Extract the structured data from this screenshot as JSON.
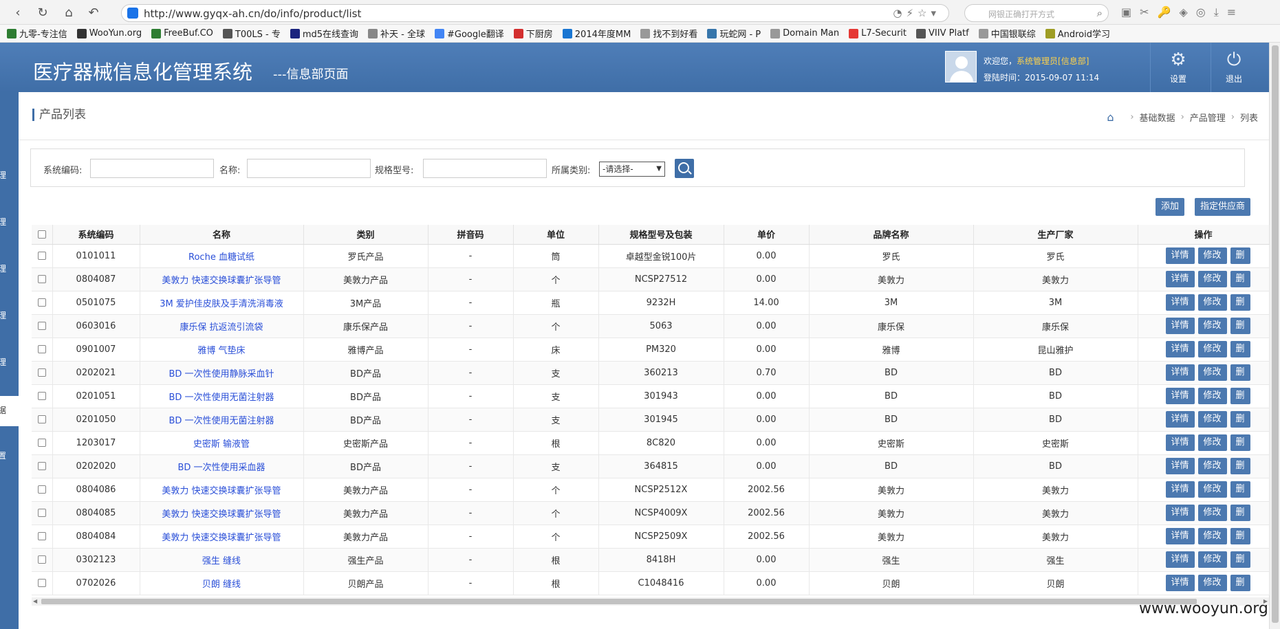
{
  "browser": {
    "url": "http://www.gyqx-ah.cn/do/info/product/list",
    "search_placeholder": "网银正确打开方式",
    "bookmarks": [
      {
        "label": "九零-专注信",
        "color": "#2e7d32"
      },
      {
        "label": "WooYun.org",
        "color": "#333333"
      },
      {
        "label": "FreeBuf.CO",
        "color": "#2e7d32"
      },
      {
        "label": "T00LS - 专",
        "color": "#555555"
      },
      {
        "label": "md5在线查询",
        "color": "#1a237e"
      },
      {
        "label": "补天 - 全球",
        "color": "#888888"
      },
      {
        "label": "#Google翻译",
        "color": "#4285f4"
      },
      {
        "label": "下厨房",
        "color": "#d32f2f"
      },
      {
        "label": "2014年度MM",
        "color": "#1976d2"
      },
      {
        "label": "找不到好看",
        "color": "#999999"
      },
      {
        "label": "玩蛇网 - P",
        "color": "#3776ab"
      },
      {
        "label": "Domain Man",
        "color": "#999999"
      },
      {
        "label": "L7-Securit",
        "color": "#e53935"
      },
      {
        "label": "VIIV Platf",
        "color": "#555555"
      },
      {
        "label": "中国银联综",
        "color": "#999999"
      },
      {
        "label": "Android学习",
        "color": "#9e9d24"
      }
    ]
  },
  "header": {
    "title": "医疗器械信息化管理系统",
    "subtitle": "---信息部页面",
    "welcome_prefix": "欢迎您，",
    "user": "系统管理员[信息部]",
    "login_time": "登陆时间：2015-09-07 11:14",
    "settings_label": "设置",
    "logout_label": "退出"
  },
  "sidebar": {
    "items": [
      "理",
      "理",
      "理",
      "理",
      "理",
      "据",
      "置"
    ]
  },
  "page": {
    "title": "产品列表",
    "breadcrumb": [
      "基础数据",
      "产品管理",
      "列表"
    ]
  },
  "filter": {
    "code_label": "系统编码:",
    "name_label": "名称:",
    "spec_label": "规格型号:",
    "category_label": "所属类别:",
    "category_selected": "-请选择-"
  },
  "toolbar": {
    "add_label": "添加",
    "assign_label": "指定供应商"
  },
  "table": {
    "columns": [
      "系统编码",
      "名称",
      "类别",
      "拼音码",
      "单位",
      "规格型号及包装",
      "单价",
      "品牌名称",
      "生产厂家",
      "操作"
    ],
    "op_labels": [
      "详情",
      "修改",
      "删"
    ],
    "rows": [
      [
        "0101011",
        "Roche 血糖试纸",
        "罗氏产品",
        "-",
        "筒",
        "卓越型金锐100片",
        "0.00",
        "罗氏",
        "罗氏"
      ],
      [
        "0804087",
        "美敦力 快速交换球囊扩张导管",
        "美敦力产品",
        "-",
        "个",
        "NCSP27512",
        "0.00",
        "美敦力",
        "美敦力"
      ],
      [
        "0501075",
        "3M 爱护佳皮肤及手清洗消毒液",
        "3M产品",
        "-",
        "瓶",
        "9232H",
        "14.00",
        "3M",
        "3M"
      ],
      [
        "0603016",
        "康乐保 抗返流引流袋",
        "康乐保产品",
        "-",
        "个",
        "5063",
        "0.00",
        "康乐保",
        "康乐保"
      ],
      [
        "0901007",
        "雅博 气垫床",
        "雅博产品",
        "-",
        "床",
        "PM320",
        "0.00",
        "雅博",
        "昆山雅护"
      ],
      [
        "0202021",
        "BD 一次性使用静脉采血针",
        "BD产品",
        "-",
        "支",
        "360213",
        "0.70",
        "BD",
        "BD"
      ],
      [
        "0201051",
        "BD 一次性使用无菌注射器",
        "BD产品",
        "-",
        "支",
        "301943",
        "0.00",
        "BD",
        "BD"
      ],
      [
        "0201050",
        "BD 一次性使用无菌注射器",
        "BD产品",
        "-",
        "支",
        "301945",
        "0.00",
        "BD",
        "BD"
      ],
      [
        "1203017",
        "史密斯 输液管",
        "史密斯产品",
        "-",
        "根",
        "8C820",
        "0.00",
        "史密斯",
        "史密斯"
      ],
      [
        "0202020",
        "BD 一次性使用采血器",
        "BD产品",
        "-",
        "支",
        "364815",
        "0.00",
        "BD",
        "BD"
      ],
      [
        "0804086",
        "美敦力 快速交换球囊扩张导管",
        "美敦力产品",
        "-",
        "个",
        "NCSP2512X",
        "2002.56",
        "美敦力",
        "美敦力"
      ],
      [
        "0804085",
        "美敦力 快速交换球囊扩张导管",
        "美敦力产品",
        "-",
        "个",
        "NCSP4009X",
        "2002.56",
        "美敦力",
        "美敦力"
      ],
      [
        "0804084",
        "美敦力 快速交换球囊扩张导管",
        "美敦力产品",
        "-",
        "个",
        "NCSP2509X",
        "2002.56",
        "美敦力",
        "美敦力"
      ],
      [
        "0302123",
        "强生 缝线",
        "强生产品",
        "-",
        "根",
        "8418H",
        "0.00",
        "强生",
        "强生"
      ],
      [
        "0702026",
        "贝朗 缝线",
        "贝朗产品",
        "-",
        "根",
        "C1048416",
        "0.00",
        "贝朗",
        "贝朗"
      ]
    ]
  },
  "footer": {
    "watermark": "www.wooyun.org"
  },
  "colors": {
    "brand": "#3f6ea7",
    "button": "#4c79b0",
    "link": "#2a4fd8",
    "user_highlight": "#ffd24a"
  }
}
